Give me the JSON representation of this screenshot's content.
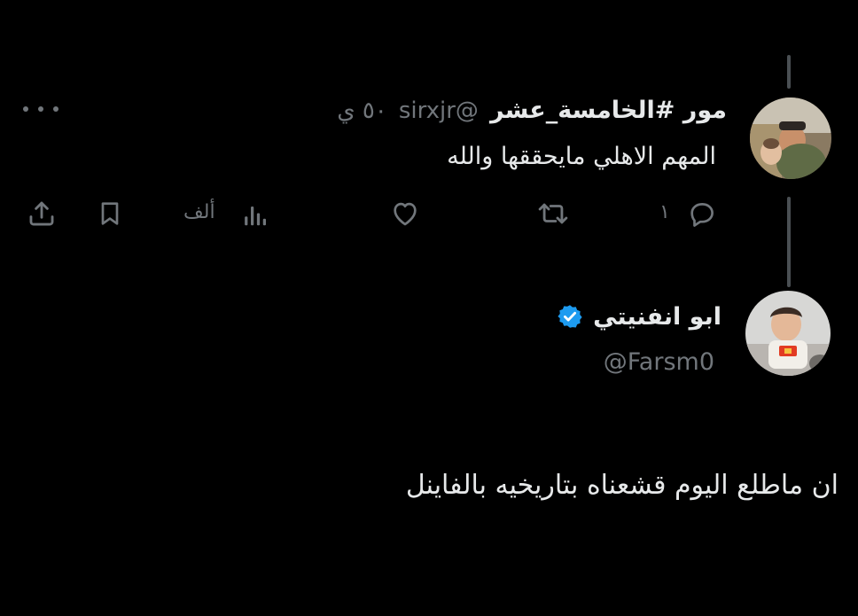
{
  "tweet": {
    "author_name": "مور #الخامسة_عشر",
    "handle": "@sirxjr",
    "time": "٥٠ ي",
    "text": "المهم الاهلي مايحققها والله",
    "reply_count": "١",
    "views_count": "ألف",
    "icons": [
      "more-icon",
      "reply-icon",
      "retweet-icon",
      "like-icon",
      "views-icon",
      "bookmark-icon",
      "share-icon"
    ]
  },
  "reply": {
    "author_name": "ابو انفنيتي",
    "handle": "@Farsm0",
    "verified": true,
    "text": "ان ماطلع اليوم قشعناه بتاريخيه بالفاينل",
    "icons": [
      "verified-badge-icon"
    ]
  },
  "colors": {
    "background": "#000000",
    "text": "#e7e9ea",
    "muted": "#71767b",
    "verified": "#1d9bf0",
    "thread_line": "#4a4f53"
  }
}
